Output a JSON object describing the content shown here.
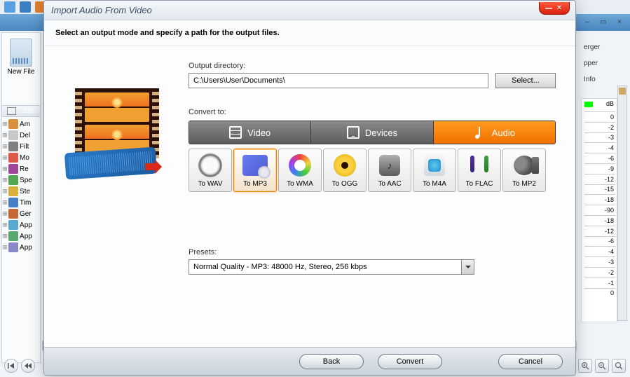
{
  "app": {
    "new_file_label": "New\nFile",
    "effects_tab": "Effe",
    "effects_items": [
      {
        "label": "Am",
        "color": "#d8903c"
      },
      {
        "label": "Del",
        "color": "#c8c8c8"
      },
      {
        "label": "Filt",
        "color": "#808080"
      },
      {
        "label": "Mo",
        "color": "#e05848"
      },
      {
        "label": "Re",
        "color": "#a04898"
      },
      {
        "label": "Spe",
        "color": "#50a850"
      },
      {
        "label": "Ste",
        "color": "#d8b03c"
      },
      {
        "label": "Tim",
        "color": "#4880c8"
      },
      {
        "label": "Ger",
        "color": "#c86838"
      },
      {
        "label": "App",
        "color": "#58a8d0"
      },
      {
        "label": "App",
        "color": "#58a870"
      },
      {
        "label": "App",
        "color": "#8888c8"
      }
    ],
    "right_items": [
      "erger",
      "pper",
      "Info"
    ],
    "meter": {
      "db_label": "dB",
      "ticks": [
        "0",
        "-2",
        "-3",
        "-4",
        "-6",
        "-9",
        "-12",
        "-15",
        "-18",
        "-90",
        "-18",
        "-12",
        "-6",
        "-4",
        "-3",
        "-2",
        "-1",
        "0"
      ]
    }
  },
  "dialog": {
    "title": "Import Audio From Video",
    "header": "Select an output mode and specify a path for the output files.",
    "output_directory_label": "Output directory:",
    "output_directory_value": "C:\\Users\\User\\Documents\\",
    "select_button": "Select...",
    "convert_to_label": "Convert to:",
    "tabs": [
      {
        "id": "video",
        "label": "Video"
      },
      {
        "id": "devices",
        "label": "Devices"
      },
      {
        "id": "audio",
        "label": "Audio",
        "active": true
      }
    ],
    "formats": [
      {
        "id": "wav",
        "label": "To WAV"
      },
      {
        "id": "mp3",
        "label": "To MP3",
        "selected": true
      },
      {
        "id": "wma",
        "label": "To WMA"
      },
      {
        "id": "ogg",
        "label": "To OGG"
      },
      {
        "id": "aac",
        "label": "To AAC"
      },
      {
        "id": "m4a",
        "label": "To M4A"
      },
      {
        "id": "flac",
        "label": "To FLAC"
      },
      {
        "id": "mp2",
        "label": "To MP2"
      }
    ],
    "presets_label": "Presets:",
    "presets_value": "Normal Quality - MP3: 48000 Hz, Stereo, 256 kbps",
    "buttons": {
      "back": "Back",
      "convert": "Convert",
      "cancel": "Cancel"
    }
  }
}
